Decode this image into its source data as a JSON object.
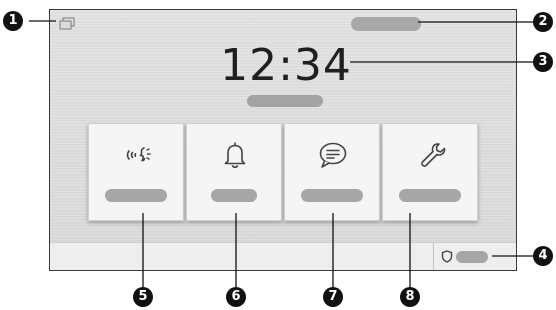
{
  "screen": {
    "status_bar": {
      "multi_window_icon": "multi-window-icon"
    },
    "clock": {
      "time": "12:34"
    },
    "tiles": [
      {
        "icon": "intercom-voice-icon"
      },
      {
        "icon": "bell-icon"
      },
      {
        "icon": "message-bubble-icon"
      },
      {
        "icon": "wrench-icon"
      }
    ],
    "bottom_bar": {
      "icon": "shield-icon"
    }
  },
  "callouts": [
    "1",
    "2",
    "3",
    "4",
    "5",
    "6",
    "7",
    "8"
  ],
  "colors": {
    "screen_background": "#dcdcdc",
    "tile_background": "#f5f5f5",
    "placeholder_pill": "#a6a6a6",
    "callout_badge": "#111111",
    "text": "#1f1f1f"
  }
}
